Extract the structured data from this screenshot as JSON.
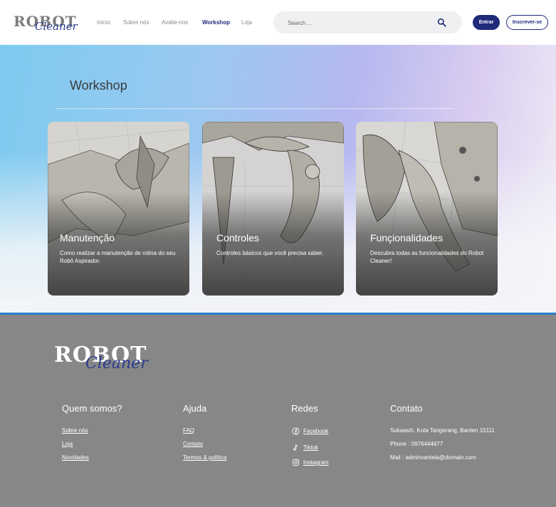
{
  "header": {
    "logo": {
      "word1": "ROBOT",
      "word2": "Cleaner"
    },
    "nav": [
      {
        "label": "Início",
        "active": false
      },
      {
        "label": "Sobre nós",
        "active": false
      },
      {
        "label": "Avalie-nos",
        "active": false
      },
      {
        "label": "Workshop",
        "active": true
      },
      {
        "label": "Loja",
        "active": false
      }
    ],
    "search": {
      "placeholder": "Search ...",
      "icon": "search-icon"
    },
    "login_label": "Entrar",
    "signup_label": "Inscrever-se",
    "accent_color": "#1f2a7a"
  },
  "hero": {
    "title": "Workshop",
    "frame_label": "Frame 50",
    "cards": [
      {
        "title": "Manutenção",
        "description": "Como realizar a manutenção de rotina do seu Robô Aspirador."
      },
      {
        "title": "Controles",
        "description": "Controles básicos que você precisa saber."
      },
      {
        "title": "Funçionalidades",
        "description": "Descubra todas as funcionalidades do Robot Cleaner!"
      }
    ]
  },
  "footer": {
    "logo": {
      "word1": "ROBOT",
      "word2": "Cleaner"
    },
    "about": {
      "title": "Quem somos?",
      "links": [
        "Sobre nós",
        "Loja",
        "Novidades"
      ]
    },
    "help": {
      "title": "Ajuda",
      "links": [
        "FAQ",
        "Contato",
        "Termos & política"
      ]
    },
    "social": {
      "title": "Redes",
      "links": [
        {
          "label": "Facebook",
          "icon": "facebook-icon"
        },
        {
          "label": "Tiktok",
          "icon": "tiktok-icon"
        },
        {
          "label": "Instagram",
          "icon": "instagram-icon"
        }
      ]
    },
    "contact": {
      "title": "Contato",
      "lines": [
        "Sukaasih, Kota Tangerang, Banten 15111",
        "Phone : 0976444677",
        "Mail : adminvantela@domain.com"
      ]
    },
    "background_color": "#878787"
  }
}
